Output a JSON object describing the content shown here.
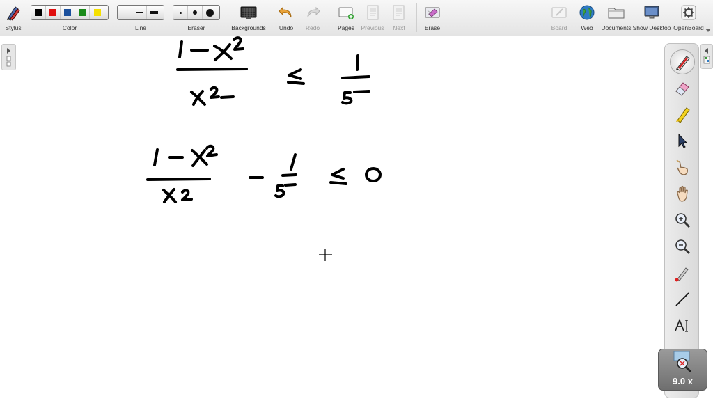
{
  "toolbar": {
    "stylus": {
      "label": "Stylus",
      "icon": "stylus-icon"
    },
    "color": {
      "label": "Color",
      "swatches": [
        "#000000",
        "#e01010",
        "#1a4f9c",
        "#1a8a1a",
        "#f5e000"
      ]
    },
    "line": {
      "label": "Line"
    },
    "eraser": {
      "label": "Eraser"
    },
    "backgrounds": {
      "label": "Backgrounds",
      "icon": "backgrounds-icon"
    },
    "undo": {
      "label": "Undo",
      "icon": "undo-icon"
    },
    "redo": {
      "label": "Redo",
      "icon": "redo-icon"
    },
    "pages": {
      "label": "Pages",
      "icon": "pages-icon"
    },
    "previous": {
      "label": "Previous",
      "icon": "previous-page-icon"
    },
    "next": {
      "label": "Next",
      "icon": "next-page-icon"
    },
    "erase": {
      "label": "Erase",
      "icon": "erase-icon"
    },
    "board": {
      "label": "Board",
      "icon": "board-icon"
    },
    "web": {
      "label": "Web",
      "icon": "globe-icon"
    },
    "documents": {
      "label": "Documents",
      "icon": "folder-icon"
    },
    "show_desktop": {
      "label": "Show Desktop",
      "icon": "monitor-icon"
    },
    "openboard": {
      "label": "OpenBoard",
      "icon": "gear-icon"
    }
  },
  "palette": {
    "tools": [
      "pen-icon",
      "eraser-icon",
      "marker-icon",
      "selector-icon",
      "interactor-hand-icon",
      "hand-icon",
      "zoom-in-icon",
      "zoom-out-icon",
      "laser-pointer-icon",
      "line-icon",
      "text-icon",
      "capture-icon"
    ],
    "zoom_level": "9.0 x"
  },
  "accent_colors": {
    "undo": "#e9a33a",
    "globe": "#2e7bc4"
  }
}
